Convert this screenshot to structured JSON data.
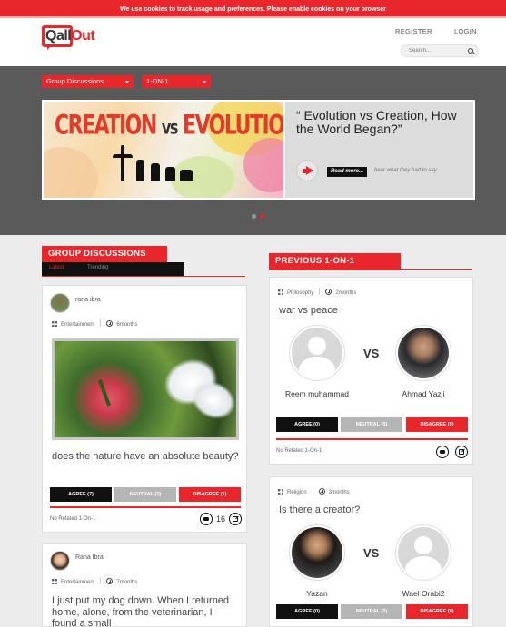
{
  "cookie_notice": "We use cookies to track usage and preferences. Please enable cookies on your browser",
  "brand": {
    "logo_left": "Qall",
    "logo_right": "Out",
    "accent": "#e8262b"
  },
  "header": {
    "register_label": "REGISTER",
    "login_label": "LOGIN",
    "search_placeholder": "Search..."
  },
  "hero": {
    "dropdown_discussions": "Group Discussions",
    "dropdown_one_on_one": "1-ON-1",
    "banner_word_1": "CREATION",
    "banner_word_vs": "vs",
    "banner_word_2": "EVOLUTION",
    "quote": "“ Evolution vs Creation, How the World Began?”",
    "read_more": "Read more...",
    "hear_what": "hear what they had to say",
    "slides": 2,
    "active_slide": 2
  },
  "group_discussions": {
    "heading": "GROUP DISCUSSIONS",
    "tabs": [
      "Latest",
      "Trending"
    ],
    "cards": [
      {
        "user": "rana ibra",
        "category": "Entertainment",
        "time": "6months",
        "image_icon": "flower-butterfly-photo",
        "title": "does the nature have an absolute beauty?",
        "agree": "AGREE (7)",
        "neutral": "NEUTRAL (3)",
        "disagree": "DISAGREE (1)",
        "no_related": "No Related 1-On-1",
        "comment_count": "16"
      },
      {
        "user": "Rana Ibra",
        "category": "Entertainment",
        "time": "7months",
        "title": "I just put my dog down. When I returned home, alone, from the veterinarian, I found a small"
      }
    ]
  },
  "previous_one_on_one": {
    "heading": "PREVIOUS 1-ON-1",
    "vs_label": "VS",
    "cards": [
      {
        "category": "Philosophy",
        "time": "2months",
        "title": "war vs peace",
        "left_name": "Reem muhammad",
        "right_name": "Ahmad Yazji",
        "agree": "AGREE (0)",
        "neutral": "NEUTRAL (0)",
        "disagree": "DISAGREE (0)",
        "no_related": "No Related 1-On-1"
      },
      {
        "category": "Religion",
        "time": "3months",
        "title": "Is there a creator?",
        "left_name": "Yazan",
        "right_name": "Wael Orabi2",
        "agree": "AGREE (0)",
        "neutral": "NEUTRAL (0)",
        "disagree": "DISAGREE (0)"
      }
    ]
  }
}
